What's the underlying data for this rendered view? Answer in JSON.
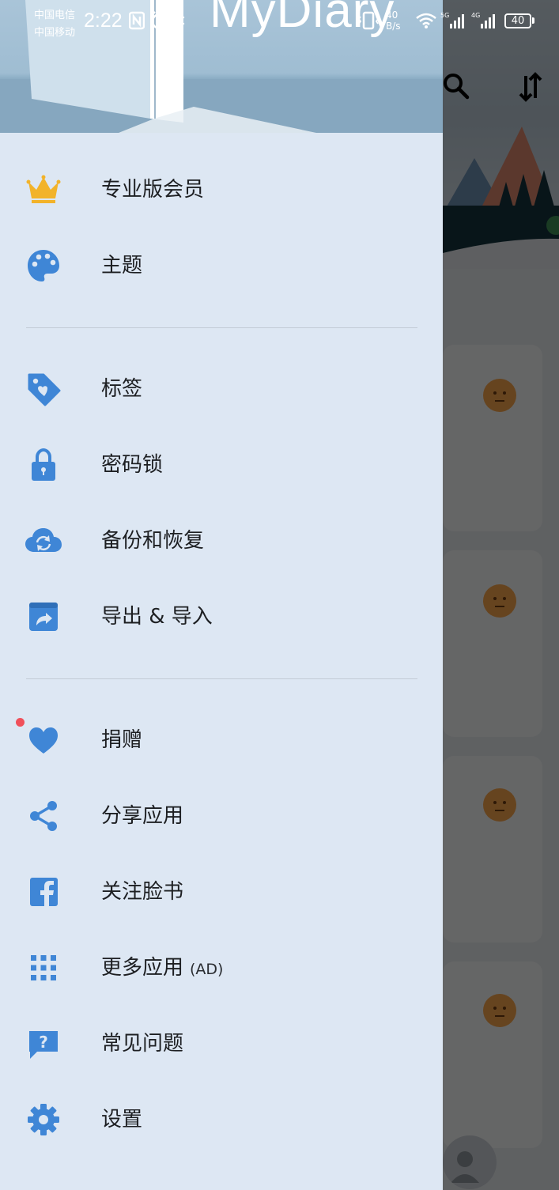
{
  "status_bar": {
    "carrier_1": "中国电信",
    "carrier_2": "中国移动",
    "time": "2:22",
    "speed_value": "40",
    "speed_unit": "B/s",
    "battery": "40",
    "icons": [
      "nfc-icon",
      "alarm-icon",
      "bluetooth-icon",
      "vibrate-icon",
      "wifi-icon",
      "signal-icon",
      "signal-icon"
    ]
  },
  "drawer": {
    "header_title": "MyDiary",
    "menu": [
      {
        "id": "pro",
        "label": "专业版会员",
        "icon": "crown-icon"
      },
      {
        "id": "theme",
        "label": "主题",
        "icon": "palette-icon"
      },
      {
        "id": "tags",
        "label": "标签",
        "icon": "tag-icon"
      },
      {
        "id": "passcode",
        "label": "密码锁",
        "icon": "lock-icon"
      },
      {
        "id": "backup",
        "label": "备份和恢复",
        "icon": "cloud-sync-icon"
      },
      {
        "id": "export",
        "label": "导出 & 导入",
        "icon": "export-icon"
      },
      {
        "id": "donate",
        "label": "捐赠",
        "icon": "heart-icon"
      },
      {
        "id": "share",
        "label": "分享应用",
        "icon": "share-icon"
      },
      {
        "id": "facebook",
        "label": "关注脸书",
        "icon": "facebook-icon"
      },
      {
        "id": "more_apps",
        "label": "更多应用",
        "sub": "(AD)",
        "icon": "apps-grid-icon"
      },
      {
        "id": "faq",
        "label": "常见问题",
        "icon": "help-icon"
      },
      {
        "id": "settings",
        "label": "设置",
        "icon": "gear-icon"
      }
    ]
  },
  "colors": {
    "drawer_bg": "#dde7f3",
    "icon_blue": "#3f86d6",
    "crown_gold": "#f2b32a",
    "notification_dot": "#f0505a",
    "mood_face": "#f4a24a"
  }
}
